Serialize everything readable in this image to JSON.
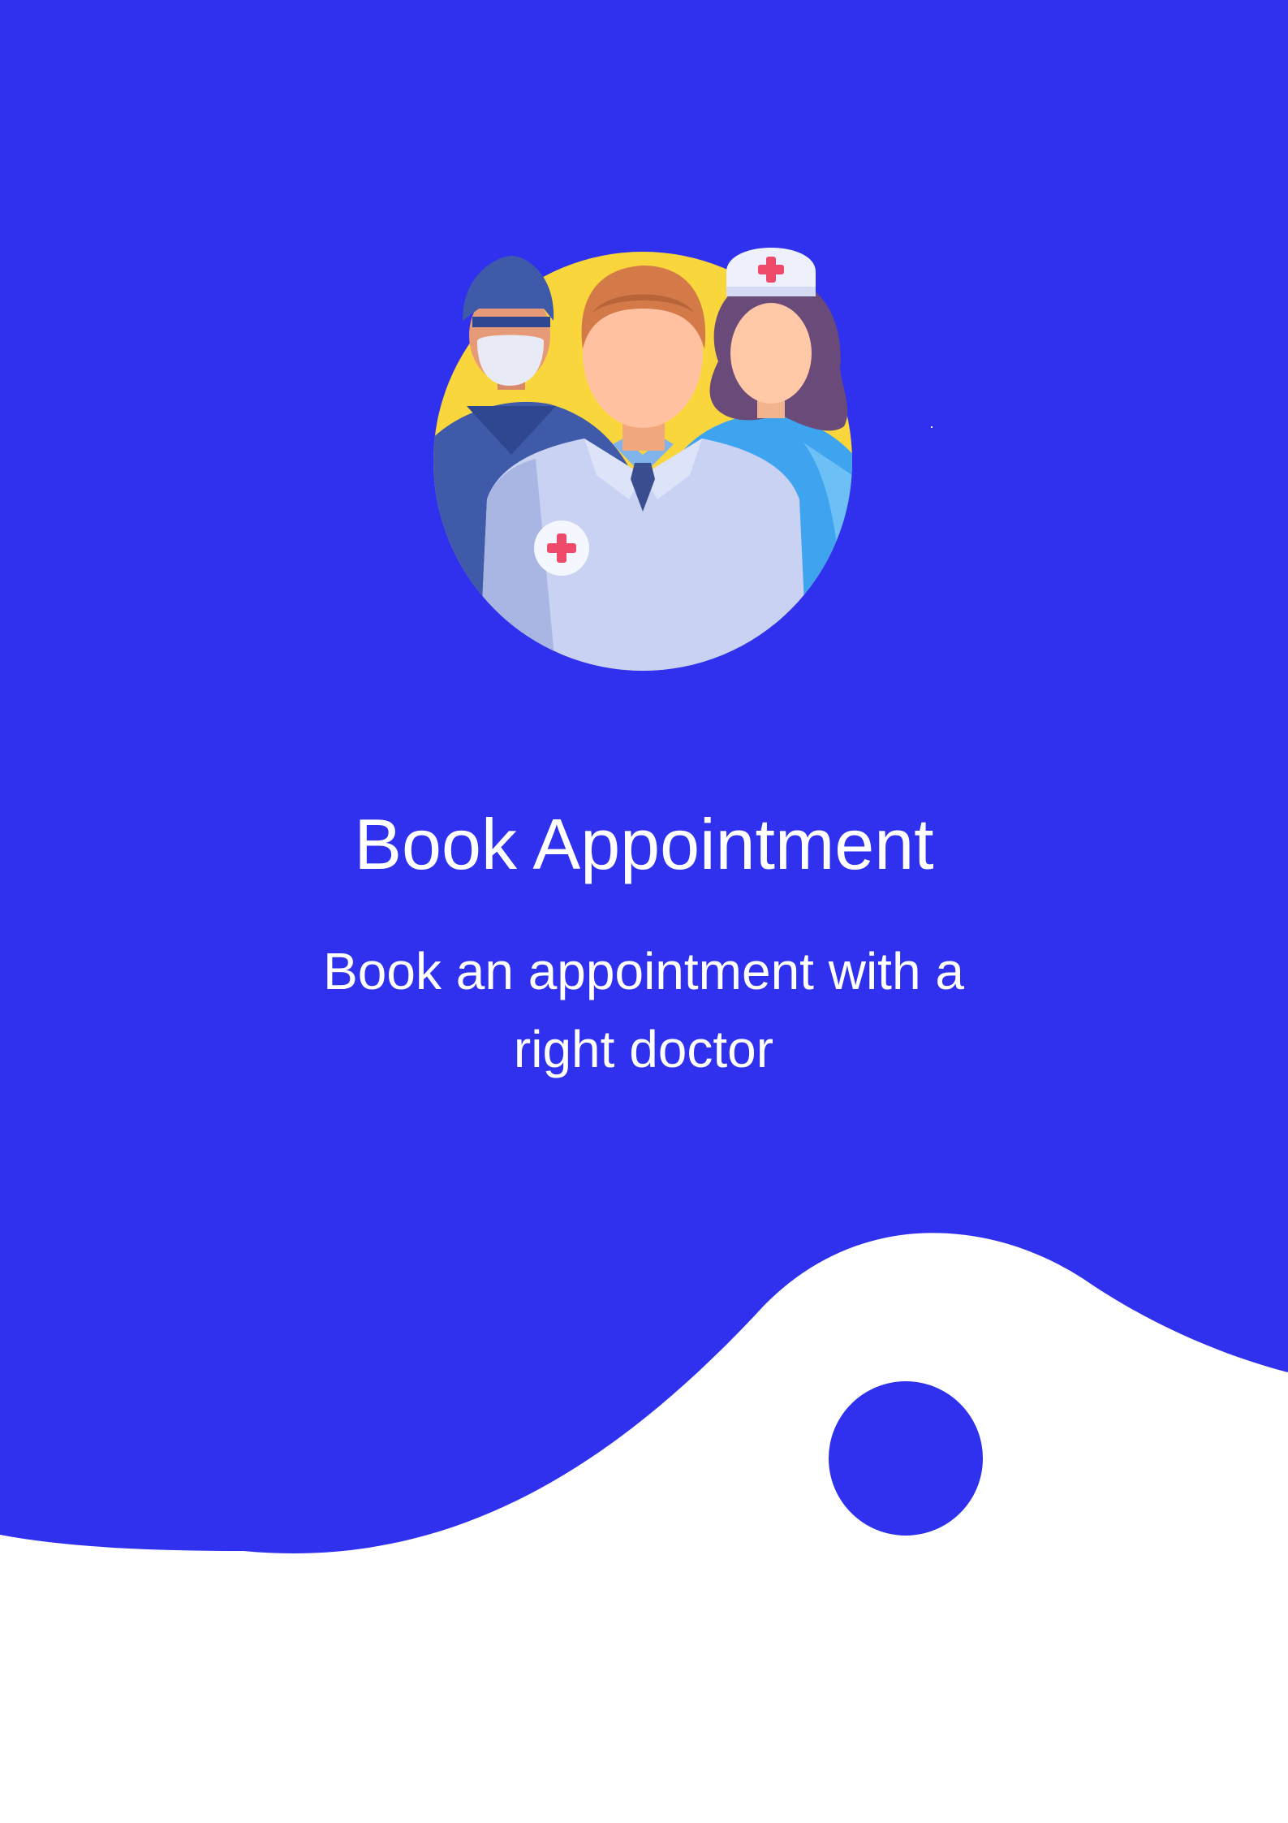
{
  "colors": {
    "primary": "#2f31ef",
    "background": "#ffffff",
    "text_on_primary": "#ffffff",
    "illustration_circle": "#f9d63b"
  },
  "illustration": {
    "icon": "medical-team-icon"
  },
  "onboarding": {
    "title": "Book Appointment",
    "description": "Book an appointment with a right doctor"
  },
  "navigation": {
    "next_button_icon": "circle-button-icon"
  }
}
